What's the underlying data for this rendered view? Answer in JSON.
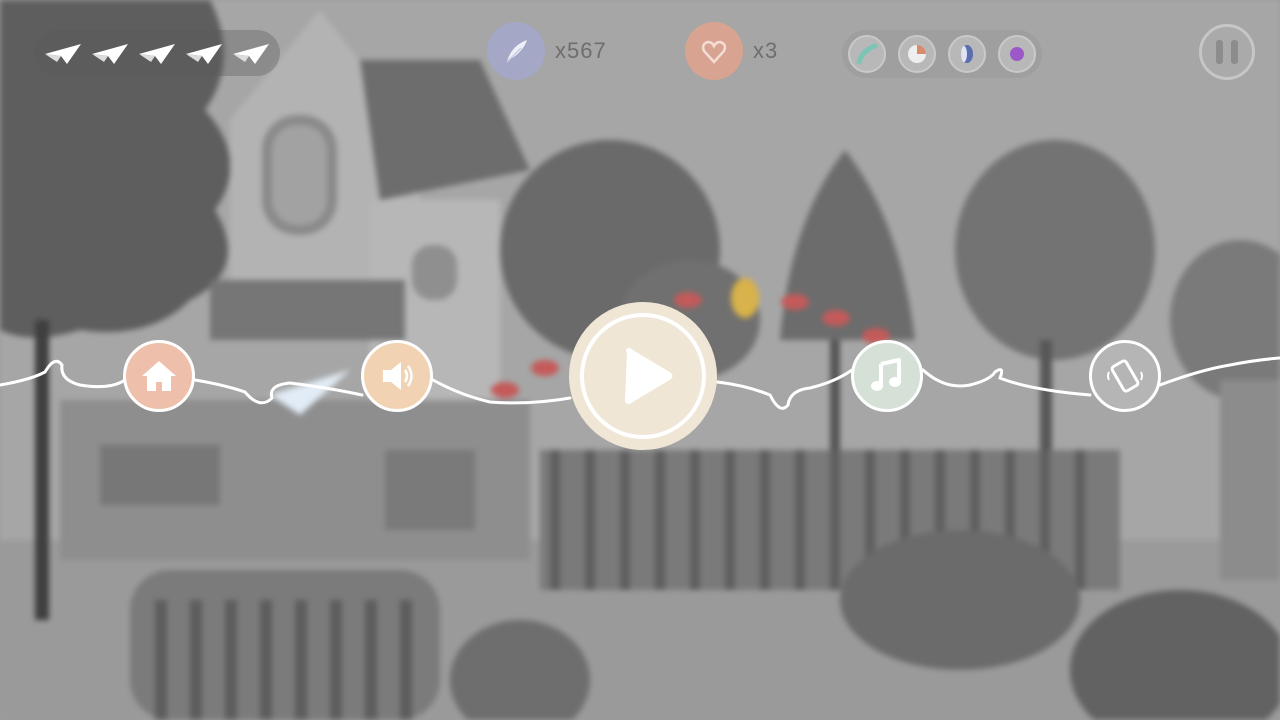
{
  "hud": {
    "planes_count": 5,
    "feathers": {
      "count_label": "x567",
      "icon": "feather-icon",
      "color": "#a4a8c6"
    },
    "lives": {
      "count_label": "x3",
      "icon": "heart-badge-icon",
      "color": "#d9a391"
    },
    "powerups": [
      {
        "icon": "swirl-icon",
        "color": "#7cc4b6"
      },
      {
        "icon": "pie-chart-icon",
        "color": "#d98a6a"
      },
      {
        "icon": "moon-icon",
        "color": "#5b6fb0"
      },
      {
        "icon": "purple-gem-icon",
        "color": "#9b59c7"
      }
    ],
    "pause_icon": "pause-icon"
  },
  "menu": {
    "home": {
      "icon": "home-icon",
      "color": "#eec0ab"
    },
    "sound": {
      "icon": "speaker-icon",
      "color": "#f1d3b3"
    },
    "play": {
      "icon": "play-icon",
      "color": "#efe6d5"
    },
    "music": {
      "icon": "music-note-icon",
      "color": "#d5e1d6"
    },
    "vibration": {
      "icon": "phone-vibrate-icon",
      "color": "#b5b5b5"
    }
  }
}
